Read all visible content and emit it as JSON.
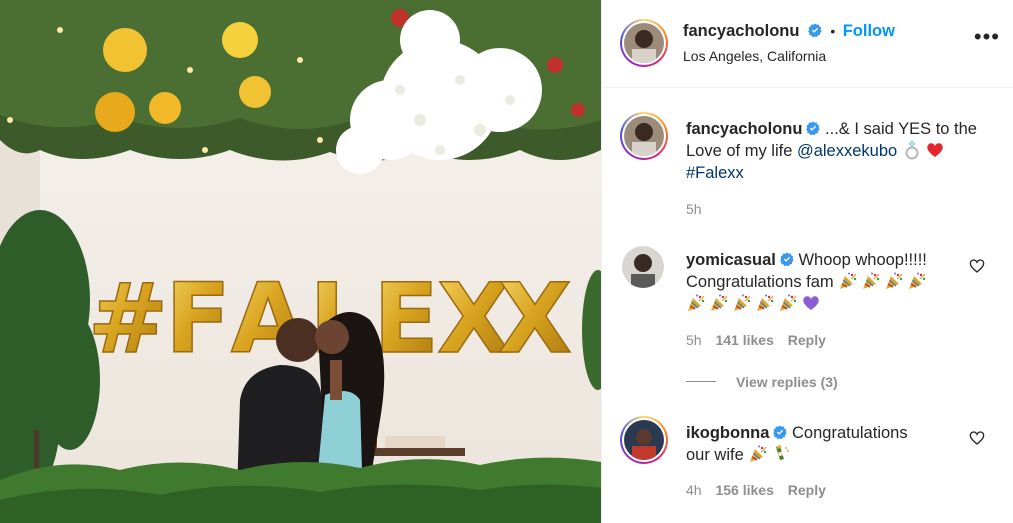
{
  "post": {
    "username": "fancyacholonu",
    "follow_separator": "•",
    "follow_label": "Follow",
    "location": "Los Angeles, California",
    "more_label": "•••",
    "photo_sign_letters": [
      "#",
      "F",
      "A",
      "L",
      "E",
      "X",
      "X"
    ],
    "caption": {
      "username": "fancyacholonu",
      "text_before": "...& I said YES to the Love of my life ",
      "mention": "@alexxekubo",
      "hashtag": "#Falexx",
      "time": "5h"
    }
  },
  "comments": [
    {
      "username": "yomicasual",
      "text_line1": "Whoop whoop!!!!!",
      "text_line2": "Congratulations fam",
      "time": "5h",
      "likes": "141 likes",
      "reply": "Reply",
      "view_replies": "View replies (3)"
    },
    {
      "username": "ikogbonna",
      "text_line1": "Congratulations",
      "text_line2": "our wife",
      "time": "4h",
      "likes": "156 likes",
      "reply": "Reply"
    }
  ],
  "colors": {
    "follow": "#0095f6",
    "mention": "#00376b",
    "verified": "#3897f0",
    "muted": "#8e8e8e",
    "balloon_gold": "#d4a21c"
  },
  "icons": [
    "verified-badge-icon",
    "more-options-icon",
    "heart-icon",
    "ring-emoji",
    "red-heart-emoji",
    "party-popper-emoji",
    "purple-heart-emoji",
    "champagne-emoji"
  ]
}
